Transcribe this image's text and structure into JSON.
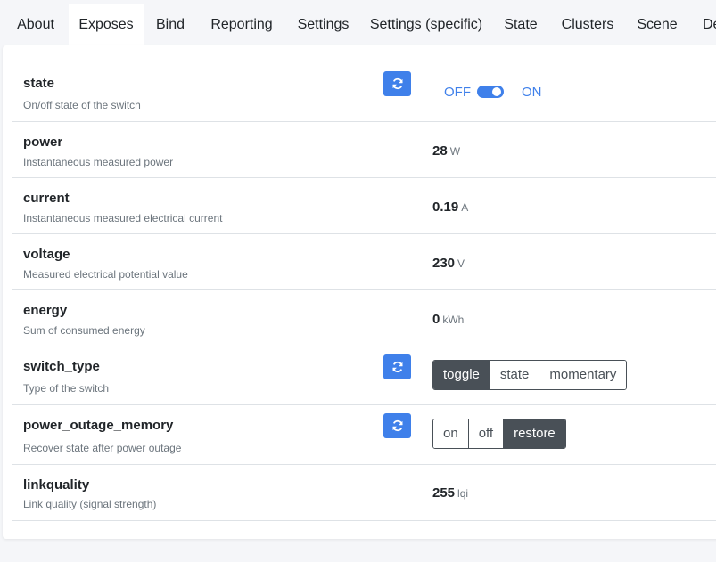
{
  "tabs": [
    {
      "label": "About"
    },
    {
      "label": "Exposes",
      "active": true
    },
    {
      "label": "Bind"
    },
    {
      "label": "Reporting"
    },
    {
      "label": "Settings"
    },
    {
      "label": "Settings (specific)"
    },
    {
      "label": "State"
    },
    {
      "label": "Clusters"
    },
    {
      "label": "Scene"
    },
    {
      "label": "De"
    }
  ],
  "icons": {
    "refresh": "refresh-icon"
  },
  "colors": {
    "accent": "#3f80ea",
    "selected": "#495057"
  },
  "exposes": {
    "state": {
      "name": "state",
      "description": "On/off state of the switch",
      "off_label": "OFF",
      "on_label": "ON",
      "value": "ON"
    },
    "power": {
      "name": "power",
      "description": "Instantaneous measured power",
      "value": "28",
      "unit": "W"
    },
    "current": {
      "name": "current",
      "description": "Instantaneous measured electrical current",
      "value": "0.19",
      "unit": "A"
    },
    "voltage": {
      "name": "voltage",
      "description": "Measured electrical potential value",
      "value": "230",
      "unit": "V"
    },
    "energy": {
      "name": "energy",
      "description": "Sum of consumed energy",
      "value": "0",
      "unit": "kWh"
    },
    "switch_type": {
      "name": "switch_type",
      "description": "Type of the switch",
      "options": [
        "toggle",
        "state",
        "momentary"
      ],
      "selected": "toggle"
    },
    "power_outage_memory": {
      "name": "power_outage_memory",
      "description": "Recover state after power outage",
      "options": [
        "on",
        "off",
        "restore"
      ],
      "selected": "restore"
    },
    "linkquality": {
      "name": "linkquality",
      "description": "Link quality (signal strength)",
      "value": "255",
      "unit": "lqi"
    }
  }
}
